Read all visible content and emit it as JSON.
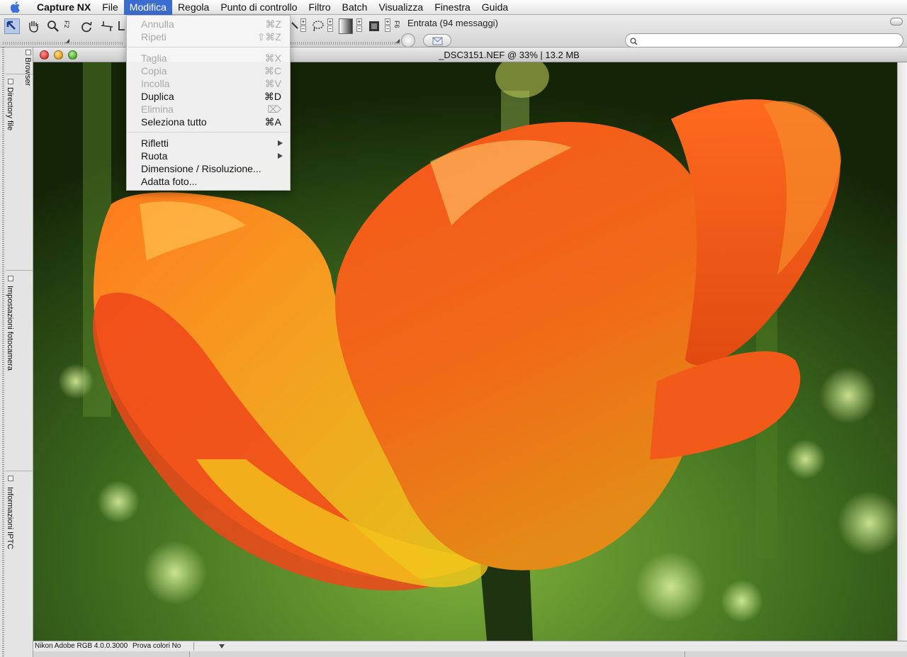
{
  "menubar": {
    "app_name": "Capture NX",
    "items": [
      "File",
      "Modifica",
      "Regola",
      "Punto di controllo",
      "Filtro",
      "Batch",
      "Visualizza",
      "Finestra",
      "Guida"
    ],
    "active_item": "Modifica"
  },
  "toolbar": {
    "fkey_left": "F2",
    "fkey_right": "F6",
    "inbox_status": "Entrata (94 messaggi)",
    "search_placeholder": ""
  },
  "palettes": {
    "browser": "Browser",
    "directory": "Directory file",
    "camera": "Impostazioni fotocamera",
    "iptc": "Informazioni IPTC"
  },
  "document": {
    "title": "_DSC3151.NEF @ 33% | 13.2 MB"
  },
  "statusbar": {
    "profile": "Nikon Adobe RGB 4.0.0.3000",
    "proof": "Prova colori No"
  },
  "edit_menu": {
    "items": [
      {
        "label": "Annulla",
        "shortcut": "⌘Z",
        "enabled": false
      },
      {
        "label": "Ripeti",
        "shortcut": "⇧⌘Z",
        "enabled": false
      },
      {
        "label": "Taglia",
        "shortcut": "⌘X",
        "enabled": false
      },
      {
        "label": "Copia",
        "shortcut": "⌘C",
        "enabled": false
      },
      {
        "label": "Incolla",
        "shortcut": "⌘V",
        "enabled": false
      },
      {
        "label": "Duplica",
        "shortcut": "⌘D",
        "enabled": true
      },
      {
        "label": "Elimina",
        "shortcut": "⌦",
        "enabled": false
      },
      {
        "label": "Seleziona tutto",
        "shortcut": "⌘A",
        "enabled": true
      },
      {
        "label": "Rifletti",
        "submenu": true,
        "enabled": true
      },
      {
        "label": "Ruota",
        "submenu": true,
        "enabled": true
      },
      {
        "label": "Dimensione / Risoluzione...",
        "enabled": true
      },
      {
        "label": "Adatta foto...",
        "enabled": true
      }
    ]
  },
  "colors": {
    "menu_highlight": "#3b6cd0",
    "close": "#e0443e",
    "minimize": "#e8a628",
    "zoom": "#5cb338"
  }
}
